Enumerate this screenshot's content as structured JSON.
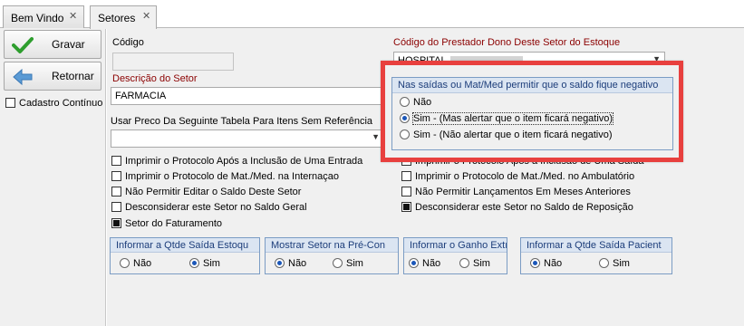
{
  "tabs": [
    {
      "label": "Bem Vindo",
      "close": "✕"
    },
    {
      "label": "Setores",
      "close": "✕"
    }
  ],
  "toolbar": {
    "save_label": "Gravar",
    "back_label": "Retornar",
    "continuous_label": "Cadastro Contínuo"
  },
  "form": {
    "code_label": "Código",
    "code_value": "",
    "provider_label": "Código do Prestador Dono Deste Setor do Estoque",
    "provider_value": "HOSPITAL",
    "description_label": "Descrição do Setor",
    "description_value": "FARMACIA",
    "price_table_label": "Usar Preco Da Seguinte Tabela Para Itens Sem Referência",
    "price_table_value": ""
  },
  "checkboxes_left": [
    {
      "label": "Imprimir o Protocolo Após a Inclusão de Uma Entrada",
      "checked": false
    },
    {
      "label": "Imprimir o Protocolo de Mat./Med. na Internaçao",
      "checked": false
    },
    {
      "label": "Não Permitir Editar o Saldo Deste Setor",
      "checked": false
    },
    {
      "label": "Desconsiderar este Setor no Saldo Geral",
      "checked": false
    },
    {
      "label": "Setor do Faturamento",
      "checked": true
    }
  ],
  "checkboxes_right": [
    {
      "label": "Imprimir o Protocolo Após a Inclusão de Uma Saída",
      "checked": false
    },
    {
      "label": "Imprimir o Protocolo de Mat./Med. no Ambulatório",
      "checked": false
    },
    {
      "label": "Não Permitir Lançamentos Em Meses Anteriores",
      "checked": false
    },
    {
      "label": "Desconsiderar este Setor no Saldo de Reposição",
      "checked": true
    }
  ],
  "negative_balance": {
    "title": "Nas saídas ou Mat/Med permitir que o saldo fique negativo",
    "options": [
      {
        "label": "Não",
        "selected": false
      },
      {
        "label": "Sim - (Mas alertar que o item ficará negativo)",
        "selected": true
      },
      {
        "label": "Sim - (Não alertar que o item ficará negativo)",
        "selected": false
      }
    ]
  },
  "radio_groups": [
    {
      "title": "Informar a Qtde Saída Estoqu",
      "no": "Não",
      "yes": "Sim",
      "selected": "yes"
    },
    {
      "title": "Mostrar Setor na Pré-Con",
      "no": "Não",
      "yes": "Sim",
      "selected": "no"
    },
    {
      "title": "Informar o Ganho Extı",
      "no": "Não",
      "yes": "Sim",
      "selected": "no"
    },
    {
      "title": "Informar a Qtde Saída Pacient",
      "no": "Não",
      "yes": "Sim",
      "selected": "no"
    }
  ],
  "icons": {
    "save": "check-icon",
    "back": "arrow-left-icon",
    "combo": "chevron-down-icon"
  },
  "colors": {
    "check_green": "#2e9e2e",
    "arrow_blue": "#5b9bd5",
    "required_label": "#8b0000",
    "highlight": "#e8403e",
    "group_title_bg": "#dbe5f2"
  }
}
